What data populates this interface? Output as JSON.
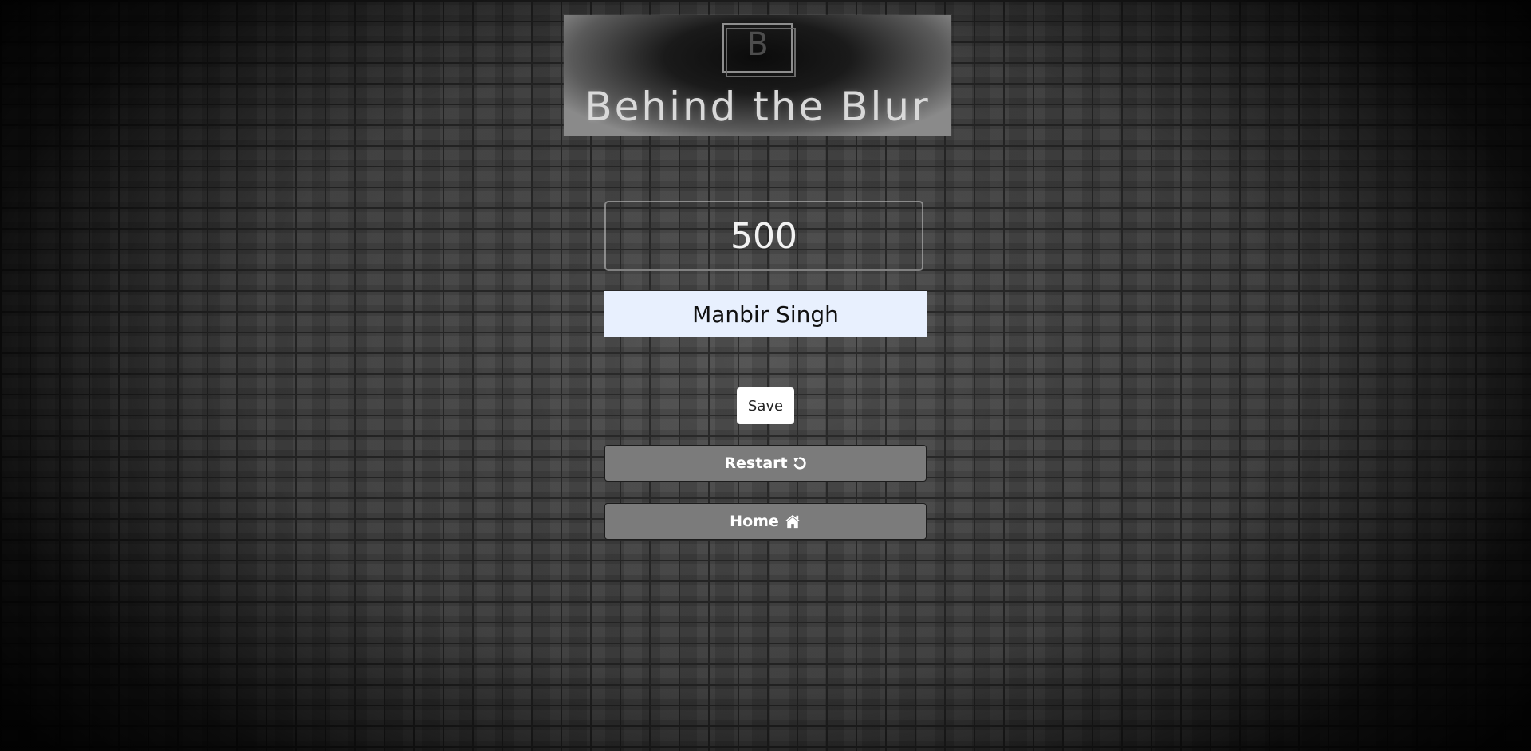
{
  "logo": {
    "letter": "B",
    "title": "Behind the Blur"
  },
  "score": "500",
  "name_input": {
    "value": "Manbir Singh"
  },
  "buttons": {
    "save_label": "Save",
    "restart_label": "Restart",
    "restart_icon": "undo-icon",
    "home_label": "Home",
    "home_icon": "home-icon"
  }
}
